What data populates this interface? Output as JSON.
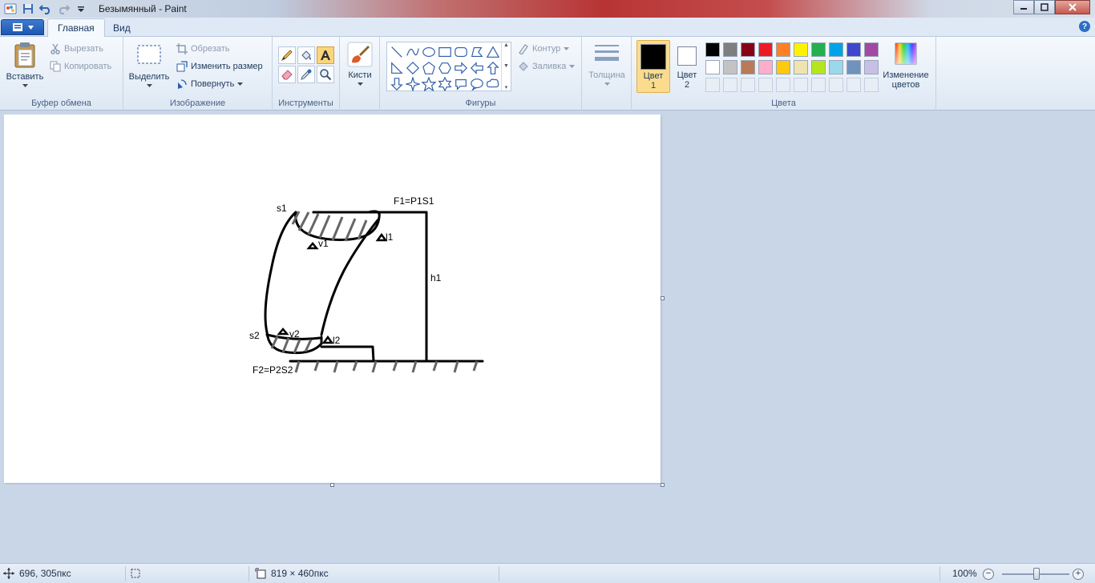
{
  "window": {
    "title": "Безымянный - Paint"
  },
  "tabs": [
    {
      "label": "Главная"
    },
    {
      "label": "Вид"
    }
  ],
  "clipboard": {
    "paste_label": "Вставить",
    "cut_label": "Вырезать",
    "copy_label": "Копировать",
    "group_label": "Буфер обмена"
  },
  "image": {
    "select_label": "Выделить",
    "crop_label": "Обрезать",
    "resize_label": "Изменить размер",
    "rotate_label": "Повернуть",
    "group_label": "Изображение"
  },
  "tools": {
    "group_label": "Инструменты",
    "active": "text"
  },
  "brushes": {
    "label": "Кисти"
  },
  "shapes": {
    "outline_label": "Контур",
    "fill_label": "Заливка",
    "group_label": "Фигуры"
  },
  "size": {
    "label": "Толщина"
  },
  "colors": {
    "color1_label": "Цвет 1",
    "color1_value": "#000000",
    "color2_label": "Цвет 2",
    "color2_value": "#ffffff",
    "edit_label": "Изменение цветов",
    "group_label": "Цвета",
    "palette_row1": [
      "#000000",
      "#7f7f7f",
      "#880015",
      "#ed1c24",
      "#ff7f27",
      "#fff200",
      "#22b14c",
      "#00a2e8",
      "#3f48cc",
      "#a349a4"
    ],
    "palette_row2": [
      "#ffffff",
      "#c3c3c3",
      "#b97a57",
      "#ffaec9",
      "#ffc90e",
      "#efe4b0",
      "#b5e61d",
      "#99d9ea",
      "#7092be",
      "#c8bfe7"
    ]
  },
  "drawing": {
    "labels": {
      "s1": "s1",
      "f1": "F1=P1S1",
      "v1": "v1",
      "l1": "l1",
      "h1": "h1",
      "s2": "s2",
      "v2": "v2",
      "l2": "l2",
      "f2": "F2=P2S2"
    }
  },
  "status": {
    "cursor_pos": "696, 305пкс",
    "canvas_size": "819 × 460пкс",
    "zoom": "100%"
  }
}
